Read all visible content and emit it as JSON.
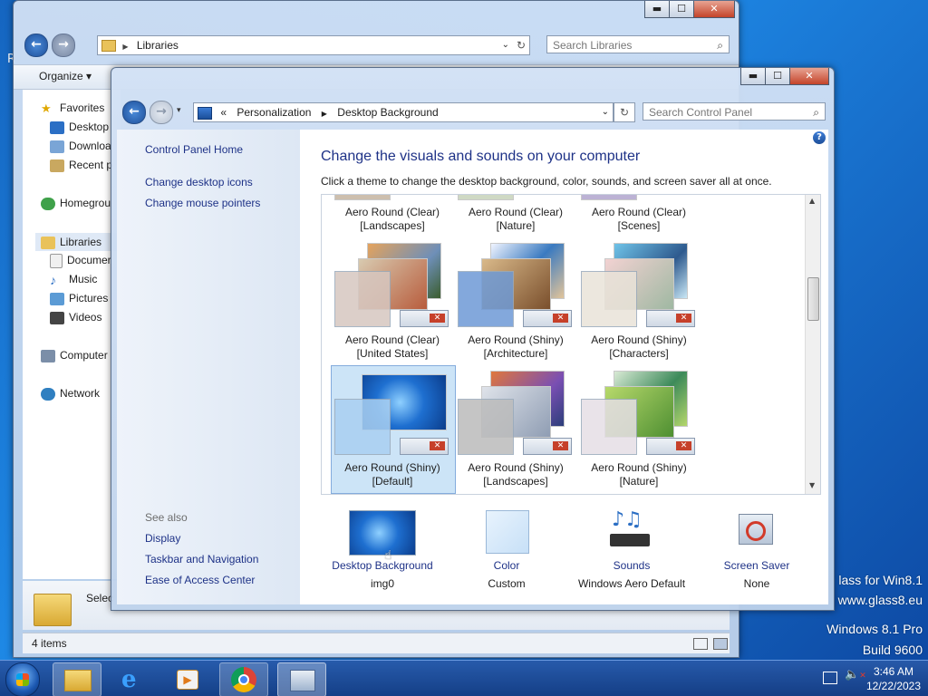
{
  "desktop": {
    "watermark_line1": "lass for Win8.1",
    "watermark_line2": "www.glass8.eu",
    "watermark_line3": "Windows 8.1 Pro",
    "watermark_line4": "Build 9600",
    "left_char": "R"
  },
  "explorer": {
    "caption": {
      "minimize": "▬",
      "maximize": "☐",
      "close": "✕"
    },
    "address": {
      "path": "Libraries",
      "chevron": "▶"
    },
    "search_placeholder": "Search Libraries",
    "organize_label": "Organize",
    "nav": {
      "favorites": "Favorites",
      "desktop": "Desktop",
      "downloads": "Downloa",
      "recent": "Recent p",
      "homegroup": "Homegrou",
      "libraries": "Libraries",
      "documents": "Documer",
      "music": "Music",
      "pictures": "Pictures",
      "videos": "Videos",
      "computer": "Computer",
      "network": "Network"
    },
    "select_text": "Selec",
    "status_items": "4 items"
  },
  "cp": {
    "caption": {
      "minimize": "▬",
      "maximize": "☐",
      "close": "✕"
    },
    "breadcrumb": {
      "prefix": "«",
      "part1": "Personalization",
      "sep": "▶",
      "part2": "Desktop Background"
    },
    "search_placeholder": "Search Control Panel",
    "left": {
      "home": "Control Panel Home",
      "desktop_icons": "Change desktop icons",
      "mouse_pointers": "Change mouse pointers",
      "see_also": "See also",
      "display": "Display",
      "taskbar_nav": "Taskbar and Navigation",
      "ease_access": "Ease of Access Center"
    },
    "heading": "Change the visuals and sounds on your computer",
    "subheading": "Click a theme to change the desktop background, color, sounds, and screen saver all at once.",
    "themes": [
      {
        "l1": "Aero Round (Clear)",
        "l2": "[Landscapes]"
      },
      {
        "l1": "Aero Round (Clear)",
        "l2": "[Nature]"
      },
      {
        "l1": "Aero Round (Clear)",
        "l2": "[Scenes]"
      },
      {
        "l1": "Aero Round (Clear)",
        "l2": "[United States]"
      },
      {
        "l1": "Aero Round (Shiny)",
        "l2": "[Architecture]"
      },
      {
        "l1": "Aero Round (Shiny)",
        "l2": "[Characters]"
      },
      {
        "l1": "Aero Round (Shiny)",
        "l2": "[Default]"
      },
      {
        "l1": "Aero Round (Shiny)",
        "l2": "[Landscapes]"
      },
      {
        "l1": "Aero Round (Shiny)",
        "l2": "[Nature]"
      }
    ],
    "bottom": {
      "bg_label": "Desktop Background",
      "bg_value": "img0",
      "color_label": "Color",
      "color_value": "Custom",
      "sounds_label": "Sounds",
      "sounds_value": "Windows Aero Default",
      "saver_label": "Screen Saver",
      "saver_value": "None"
    },
    "help": "?"
  },
  "taskbar": {
    "time": "3:46 AM",
    "date": "12/22/2023"
  },
  "colors": {
    "link": "#1e3287",
    "selection": "#cce4f7",
    "accent_blue": "#1e88e5"
  }
}
